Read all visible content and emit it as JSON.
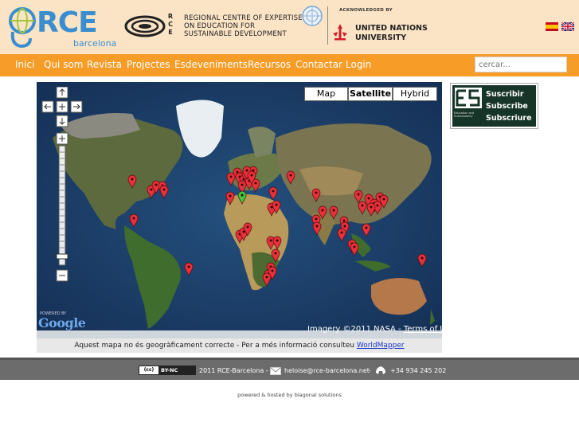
{
  "header": {
    "logo_text": "RCE",
    "logo_sub": "barcelona",
    "rce_vertical": [
      "R",
      "C",
      "E"
    ],
    "centre_lines": [
      "REGIONAL CENTRE OF EXPERTISE",
      "ON EDUCATION FOR",
      "SUSTAINABLE DEVELOPMENT"
    ],
    "acknowledged": "ACKNOWLEDGED BY",
    "unu_lines": [
      "UNITED NATIONS",
      "UNIVERSITY"
    ],
    "flags": [
      "flag-es",
      "flag-uk"
    ]
  },
  "nav": {
    "items": [
      "Inici",
      "Qui som",
      "Revista",
      "Projectes",
      "Esdeveniments",
      "Recursos",
      "Contactar",
      "Login"
    ]
  },
  "search": {
    "placeholder": "cercar..."
  },
  "map": {
    "types": [
      "Map",
      "Satellite",
      "Hybrid"
    ],
    "active_type": "Satellite",
    "imagery": "Imagery ©2011 NASA - ",
    "terms": "Terms of Use",
    "powered_by": "POWERED BY",
    "google": "Google",
    "controls": [
      "pan-up",
      "pan-left",
      "pan-center",
      "pan-right",
      "pan-down",
      "zoom-in",
      "zoom-out"
    ]
  },
  "caption": {
    "text": "Aquest mapa no és geogràficament correcte - Per a més informació consulteu ",
    "link": "WorldMapper"
  },
  "subscribe": {
    "lines": [
      "Suscribir",
      "Subscribe",
      "Subscriure"
    ],
    "small": "Education and Sustainability"
  },
  "footer": {
    "license": "BY-NC",
    "copyright": "2011 RCE-Barcelona -",
    "email": "heloise@rce-barcelona.net",
    "separator": "-",
    "phone": "+34 934 245 202"
  },
  "powered": "powered & hosted by biagonal solutions",
  "colors": {
    "header_bg": "#fbe4c6",
    "nav_bg": "#f79c26",
    "logo_blue": "#3a8ed0",
    "marker_red": "#e8313a",
    "marker_green": "#3cc83a",
    "footer_bg": "#6c6c6c"
  }
}
